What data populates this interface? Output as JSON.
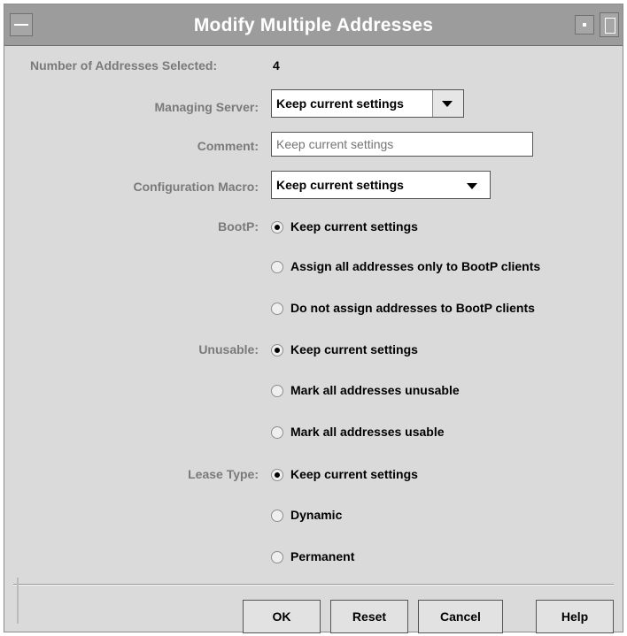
{
  "window": {
    "title": "Modify Multiple Addresses"
  },
  "selected": {
    "label": "Number of Addresses Selected:",
    "value": "4"
  },
  "managing_server": {
    "label": "Managing Server:",
    "value": "Keep current settings"
  },
  "comment": {
    "label": "Comment:",
    "placeholder": "Keep current settings"
  },
  "config_macro": {
    "label": "Configuration Macro:",
    "value": "Keep current settings"
  },
  "bootp": {
    "label": "BootP:",
    "options": [
      "Keep current settings",
      "Assign all addresses only to BootP clients",
      "Do not assign addresses to BootP clients"
    ],
    "selected": 0
  },
  "unusable": {
    "label": "Unusable:",
    "options": [
      "Keep current settings",
      "Mark all addresses unusable",
      "Mark all addresses usable"
    ],
    "selected": 0
  },
  "lease_type": {
    "label": "Lease Type:",
    "options": [
      "Keep current settings",
      "Dynamic",
      "Permanent"
    ],
    "selected": 0
  },
  "buttons": {
    "ok": "OK",
    "reset": "Reset",
    "cancel": "Cancel",
    "help": "Help"
  }
}
